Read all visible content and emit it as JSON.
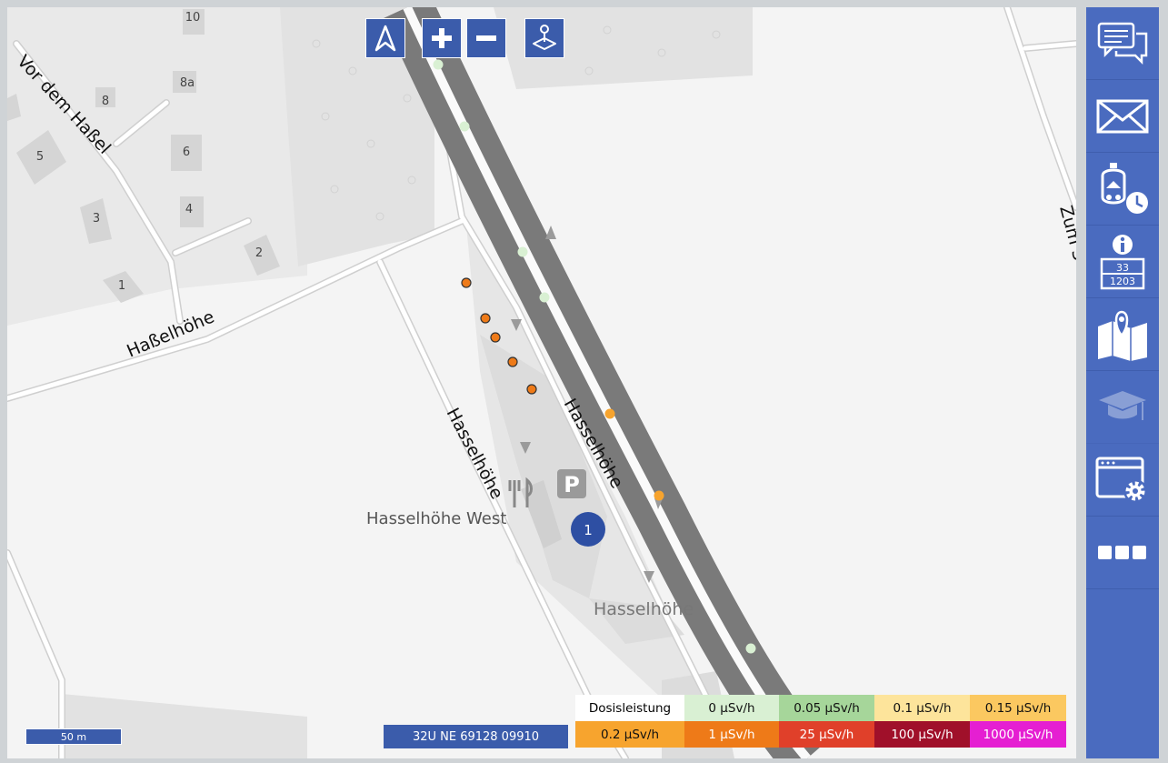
{
  "map": {
    "streets": {
      "vor_dem_hassel": "Vor dem Haßel",
      "hasselhoehe_top": "Haßelhöhe",
      "hasselhoehe_west_road": "Hasselhöhe",
      "hasselhoehe_east_road": "Hasselhöhe",
      "zum": "Zum S"
    },
    "places": {
      "hasselhoehe_west": "Hasselhöhe West",
      "hasselhoehe": "Hasselhöhe"
    },
    "house_numbers": [
      "10",
      "8a",
      "8",
      "5",
      "6",
      "3",
      "4",
      "2",
      "1"
    ],
    "cluster_count": "1",
    "parking_symbol": "P"
  },
  "controls": {
    "north_icon": "north-arrow-icon",
    "zoom_in_icon": "plus-icon",
    "zoom_out_icon": "minus-icon",
    "locate_icon": "joystick-icon"
  },
  "sidebar": {
    "items": [
      {
        "icon": "chat-icon"
      },
      {
        "icon": "mail-icon"
      },
      {
        "icon": "breathing-mask-timer-icon"
      },
      {
        "icon": "hazard-info-sign-icon",
        "top_number": "33",
        "bottom_number": "1203"
      },
      {
        "icon": "map-pin-icon"
      },
      {
        "icon": "graduation-cap-icon",
        "disabled": true
      },
      {
        "icon": "window-settings-icon"
      },
      {
        "icon": "more-icon"
      }
    ]
  },
  "status": {
    "coordinates": "32U NE 69128 09910",
    "scale": "50 m"
  },
  "legend": {
    "title": "Dosisleistung",
    "entries": [
      {
        "label": "0 µSv/h",
        "color": "#d9f0d3",
        "text": "#111111"
      },
      {
        "label": "0.05 µSv/h",
        "color": "#a6d69a",
        "text": "#111111"
      },
      {
        "label": "0.1 µSv/h",
        "color": "#fde49b",
        "text": "#111111"
      },
      {
        "label": "0.15 µSv/h",
        "color": "#fbc860",
        "text": "#111111"
      },
      {
        "label": "0.2 µSv/h",
        "color": "#f7a42e",
        "text": "#111111"
      },
      {
        "label": "1 µSv/h",
        "color": "#ee7a18",
        "text": "#ffffff"
      },
      {
        "label": "25 µSv/h",
        "color": "#e0402a",
        "text": "#ffffff"
      },
      {
        "label": "100 µSv/h",
        "color": "#a0102a",
        "text": "#ffffff"
      },
      {
        "label": "1000 µSv/h",
        "color": "#e51fd2",
        "text": "#ffffff"
      }
    ]
  },
  "colors": {
    "accent": "#3b5cab",
    "sidebar": "#4a6bbf",
    "marker_orange": "#ee7a18",
    "marker_light_orange": "#f7a42e",
    "marker_light_green": "#d9f0d3"
  }
}
